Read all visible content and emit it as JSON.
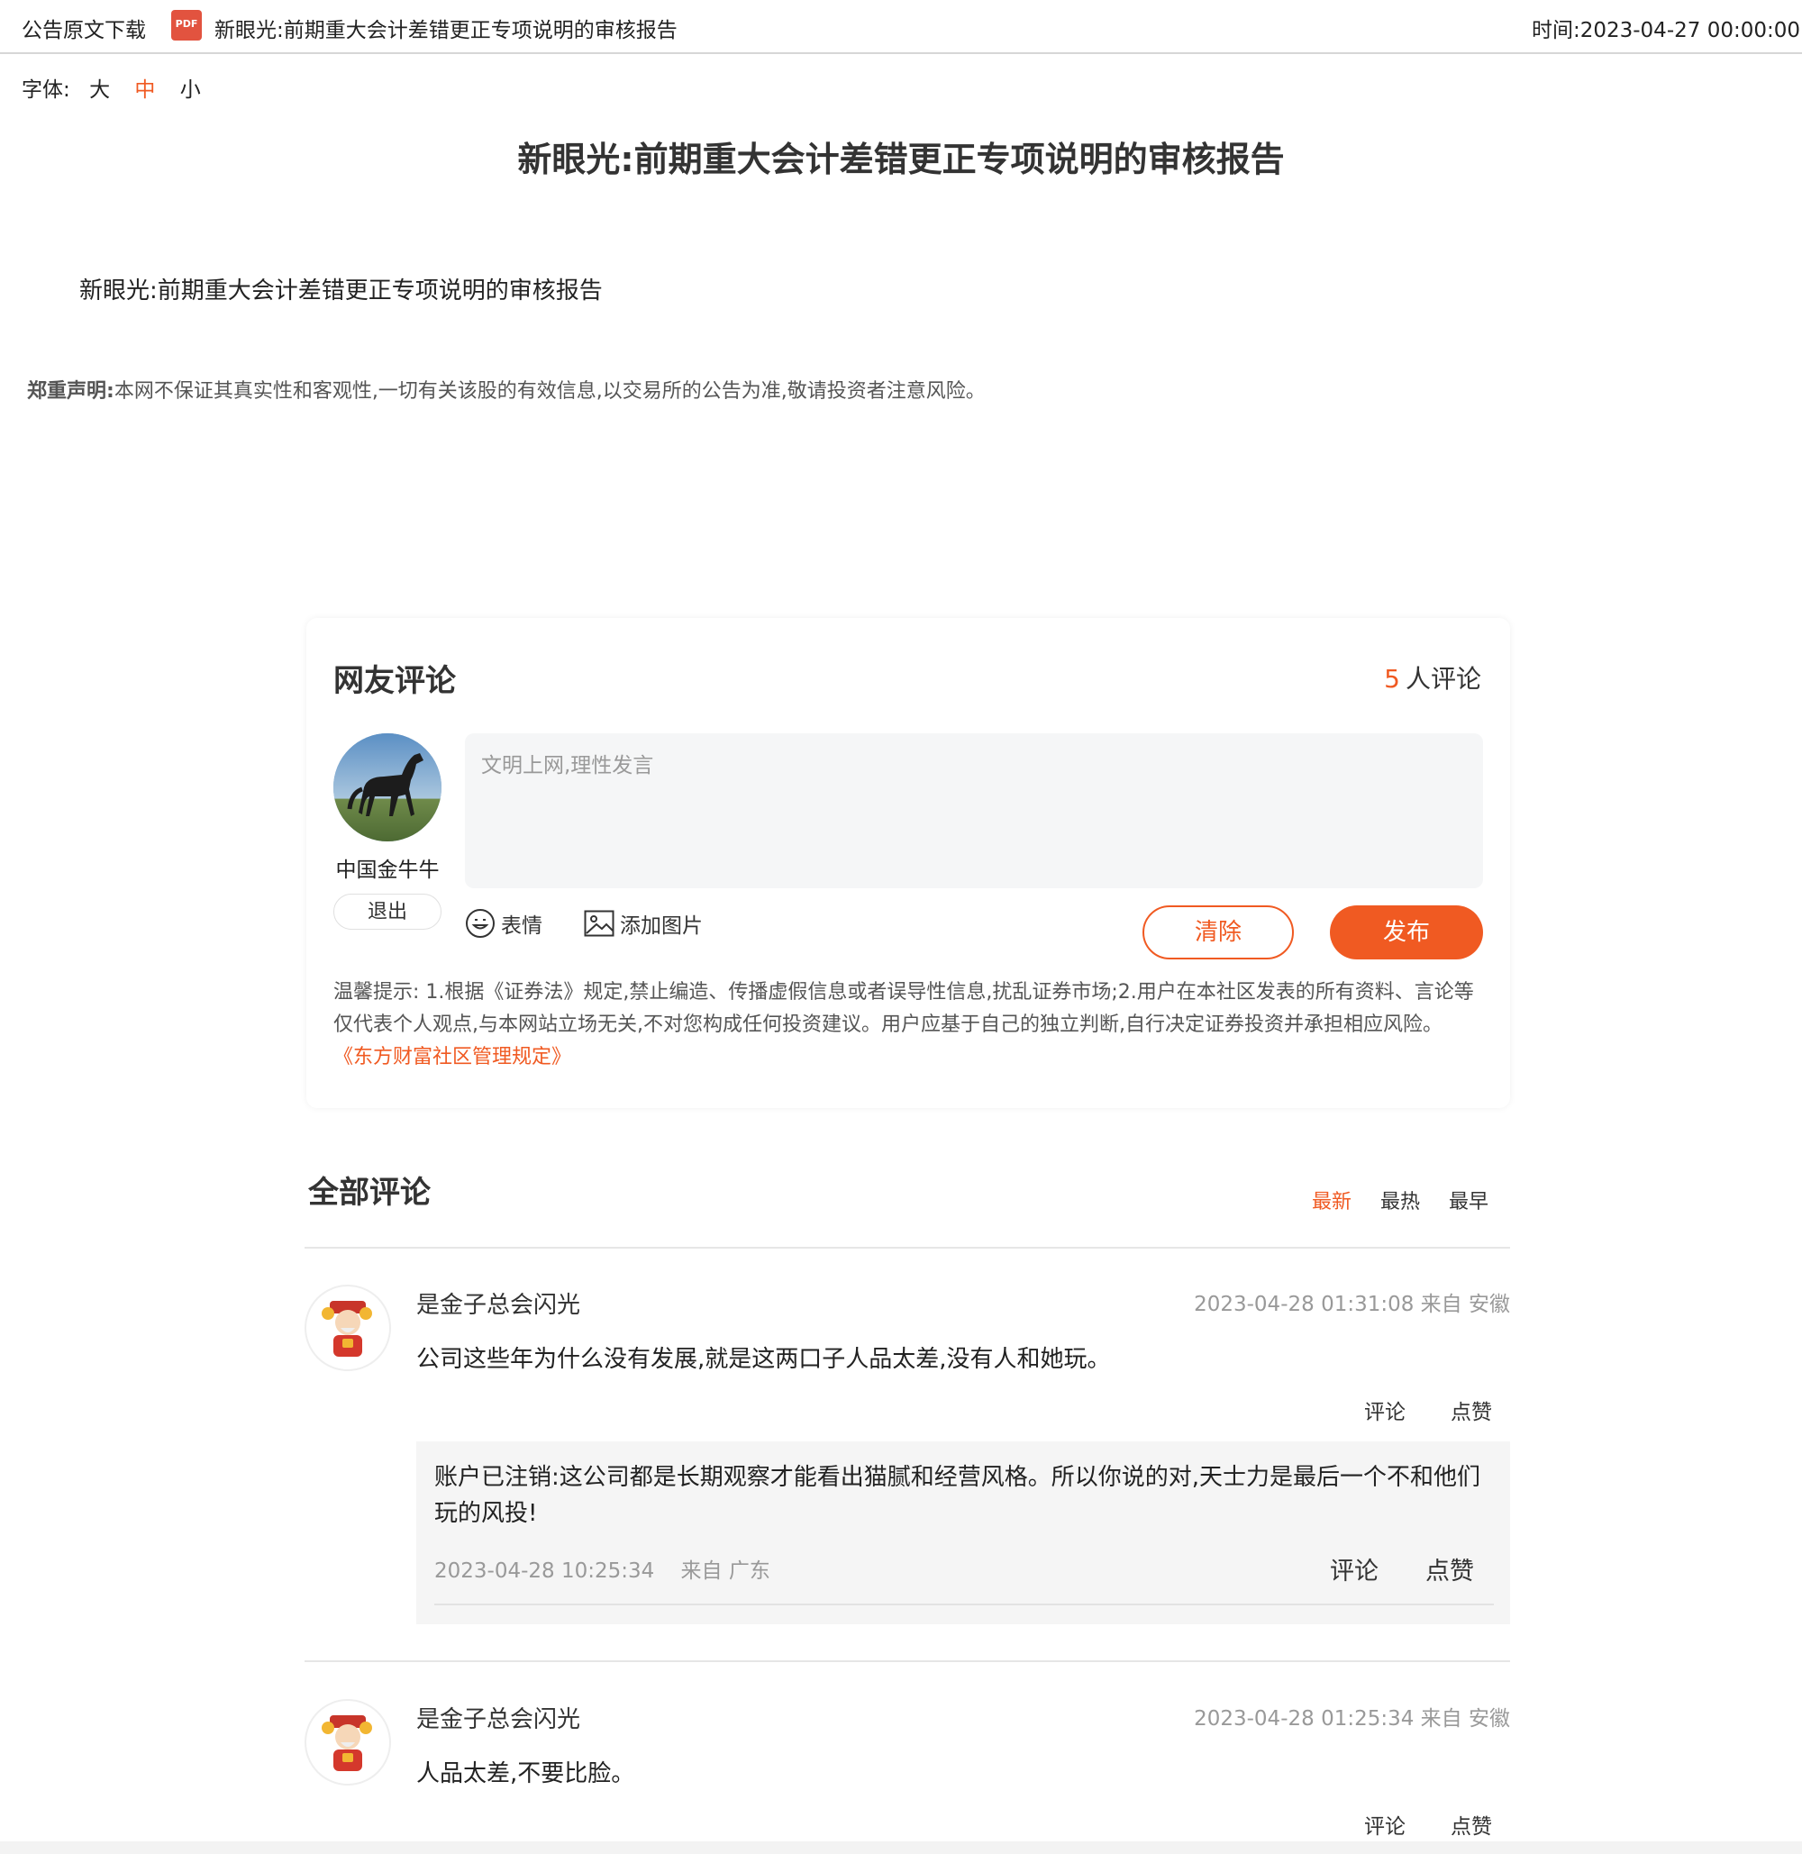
{
  "topbar": {
    "download_label": "公告原文下载",
    "pdf_icon_text": "PDF",
    "doc_title": "新眼光:前期重大会计差错更正专项说明的审核报告",
    "time_label": "时间:",
    "time_value": "2023-04-27 00:00:00"
  },
  "font_size": {
    "label": "字体:",
    "options": [
      "大",
      "中",
      "小"
    ],
    "selected": "中"
  },
  "article": {
    "title": "新眼光:前期重大会计差错更正专项说明的审核报告",
    "body": "新眼光:前期重大会计差错更正专项说明的审核报告",
    "disclaimer_label": "郑重声明:",
    "disclaimer_text": "本网不保证其真实性和客观性,一切有关该股的有效信息,以交易所的公告为准,敬请投资者注意风险。"
  },
  "editor": {
    "title": "网友评论",
    "count": "5",
    "count_suffix": "人评论",
    "username": "中国金牛牛",
    "logout_label": "退出",
    "placeholder": "文明上网,理性发言",
    "emoji_label": "表情",
    "image_label": "添加图片",
    "clear_label": "清除",
    "post_label": "发布",
    "tip_text": "温馨提示: 1.根据《证券法》规定,禁止编造、传播虚假信息或者误导性信息,扰乱证券市场;2.用户在本社区发表的所有资料、言论等仅代表个人观点,与本网站立场无关,不对您构成任何投资建议。用户应基于自己的独立判断,自行决定证券投资并承担相应风险。",
    "rules_link": "《东方财富社区管理规定》"
  },
  "comments_section": {
    "title": "全部评论",
    "sort_options": [
      "最新",
      "最热",
      "最早"
    ],
    "sort_selected": "最新",
    "comments": [
      {
        "user": "是金子总会闪光",
        "meta": "2023-04-28 01:31:08 来自 安徽",
        "text": "公司这些年为什么没有发展,就是这两口子人品太差,没有人和她玩。",
        "reply_label": "评论",
        "like_label": "点赞",
        "reply": {
          "text": "账户已注销:这公司都是长期观察才能看出猫腻和经营风格。所以你说的对,天士力是最后一个不和他们玩的风投!",
          "time": "2023-04-28 10:25:34",
          "location": "来自 广东",
          "reply_label": "评论",
          "like_label": "点赞"
        }
      },
      {
        "user": "是金子总会闪光",
        "meta": "2023-04-28 01:25:34 来自 安徽",
        "text": "人品太差,不要比脸。",
        "reply_label": "评论",
        "like_label": "点赞"
      }
    ]
  },
  "colors": {
    "accent": "#f05a22",
    "text": "#222222",
    "muted": "#999999",
    "panel_bg": "#f5f6f7"
  }
}
